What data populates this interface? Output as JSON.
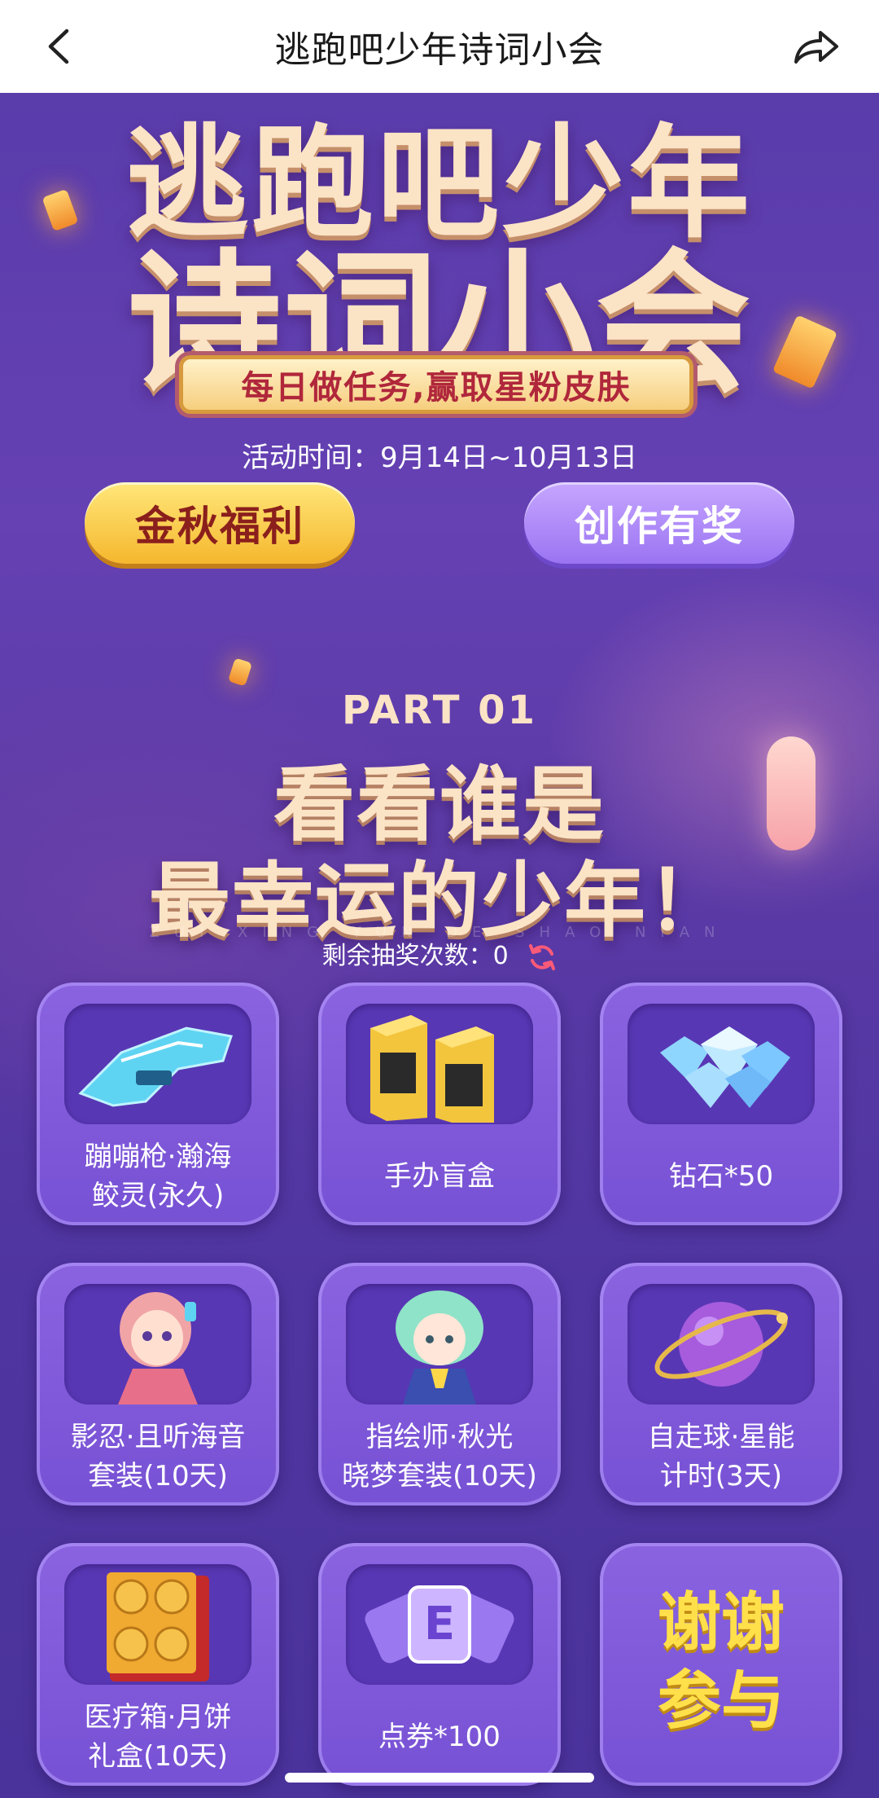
{
  "nav": {
    "title": "逃跑吧少年诗词小会"
  },
  "hero": {
    "title_line1": "逃跑吧少年",
    "title_line2": "诗词小会",
    "ribbon": "每日做任务,赢取星粉皮肤",
    "activity_time": "活动时间：9月14日~10月13日",
    "btn_welfare": "金秋福利",
    "btn_create": "创作有奖"
  },
  "part": {
    "label": "PART 01",
    "title_line1": "看看谁是",
    "title_line2": "最幸运的少年！",
    "pinyin": "ZUI XING YUN DE SHAO NIAN",
    "draws_label": "剩余抽奖次数：",
    "draws_count": "0"
  },
  "prizes": [
    {
      "line1": "蹦嘣枪·瀚海",
      "line2": "鲛灵(永久)",
      "icon": "gun-icon"
    },
    {
      "line1": "手办盲盒",
      "line2": "",
      "icon": "blind-box-icon"
    },
    {
      "line1": "钻石*50",
      "line2": "",
      "icon": "diamond-icon"
    },
    {
      "line1": "影忍·且听海音",
      "line2": "套装(10天)",
      "icon": "character-ninja-icon"
    },
    {
      "line1": "指绘师·秋光",
      "line2": "晓梦套装(10天)",
      "icon": "character-painter-icon"
    },
    {
      "line1": "自走球·星能",
      "line2": "计时(3天)",
      "icon": "orb-icon"
    },
    {
      "line1": "医疗箱·月饼",
      "line2": "礼盒(10天)",
      "icon": "mooncake-box-icon"
    },
    {
      "line1": "点券*100",
      "line2": "",
      "icon": "coupon-icon"
    },
    {
      "line1": "谢谢",
      "line2": "参与",
      "icon": ""
    }
  ],
  "colors": {
    "background": "#5b3aa8",
    "title_cream": "#fbe3c6",
    "gold": "#f5b72d",
    "thanks_yellow": "#ffe04a"
  }
}
